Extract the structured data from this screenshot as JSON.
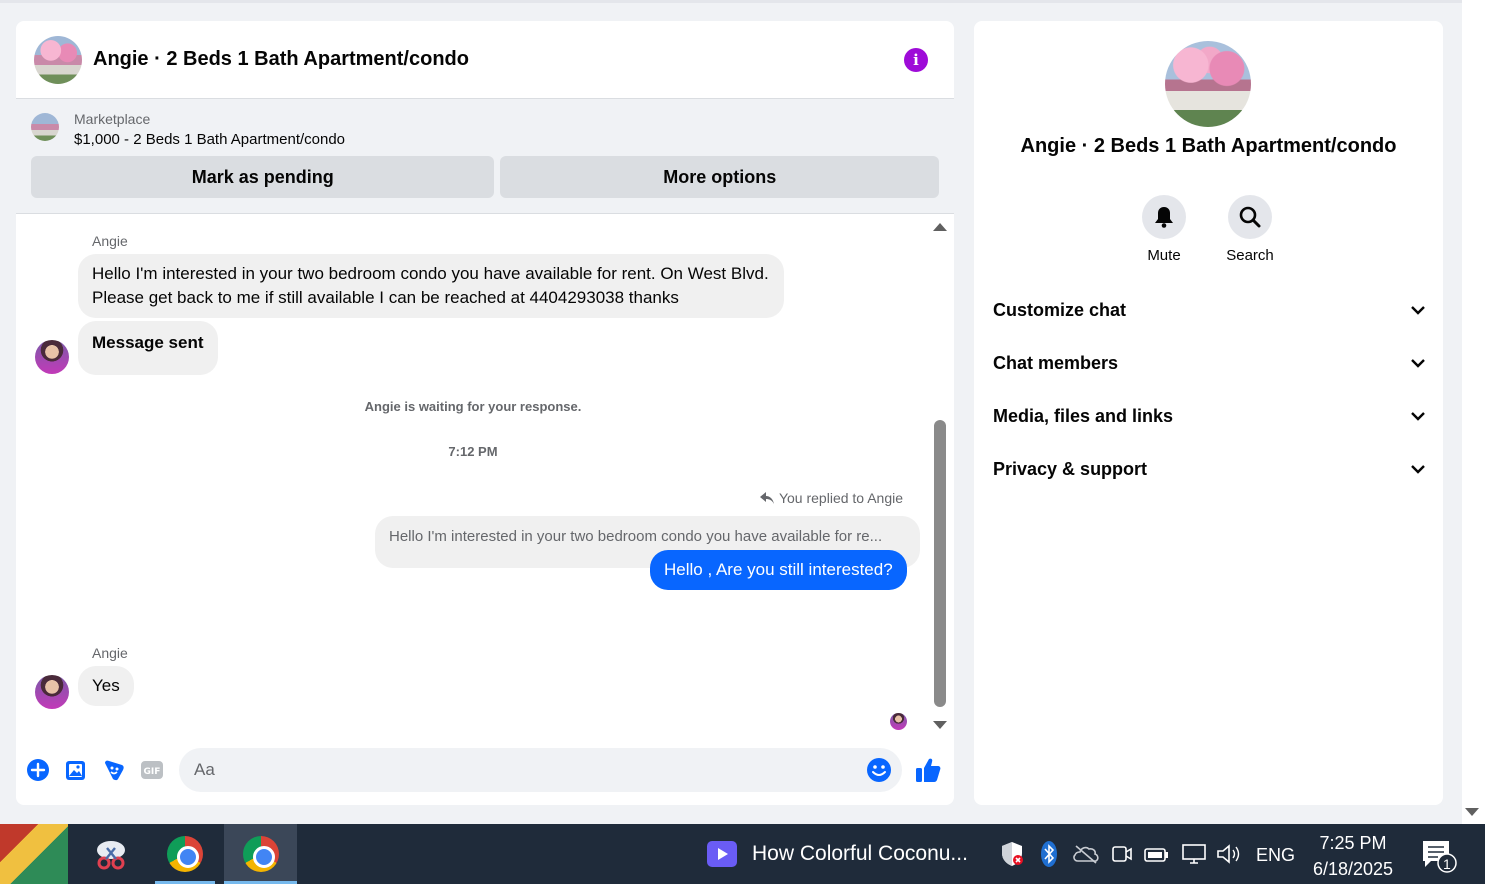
{
  "chat": {
    "title": "Angie · 2 Beds 1 Bath Apartment/condo",
    "marketplace_label": "Marketplace",
    "listing": "$1,000 - 2 Beds 1 Bath Apartment/condo",
    "mark_pending_label": "Mark as pending",
    "more_options_label": "More options",
    "messages": {
      "sender1": "Angie",
      "msg1": "Hello I'm interested in your two bedroom condo you have available for rent. On West Blvd. Please get back to me if still available I can be reached at 4404293038 thanks",
      "msg2": "Message sent",
      "waiting": "Angie is waiting for your response.",
      "time": "7:12 PM",
      "replied_note": "You replied to Angie",
      "quoted": "Hello I'm interested in your two bedroom condo you have available for re...",
      "reply": "Hello , Are you still interested?",
      "sender2": "Angie",
      "msg3": "Yes"
    },
    "composer": {
      "placeholder": "Aa"
    }
  },
  "info_panel": {
    "title": "Angie · 2 Beds 1 Bath Apartment/condo",
    "mute_label": "Mute",
    "search_label": "Search",
    "sections": [
      "Customize chat",
      "Chat members",
      "Media, files and links",
      "Privacy & support"
    ]
  },
  "taskbar": {
    "media_title": "How Colorful Coconu...",
    "language": "ENG",
    "time": "7:25 PM",
    "date": "6/18/2025",
    "notification_count": "1"
  },
  "colors": {
    "accent": "#0866ff",
    "info_purple": "#9e0bd8"
  }
}
